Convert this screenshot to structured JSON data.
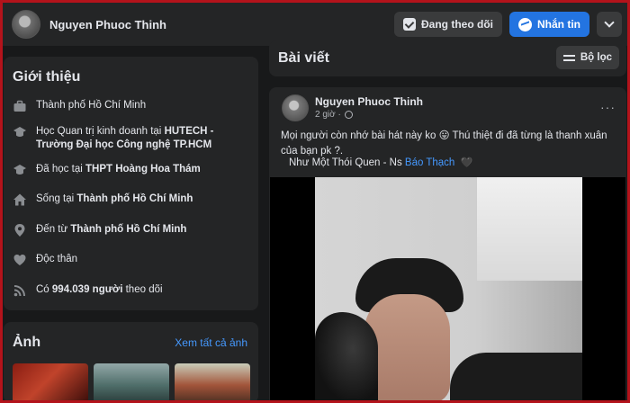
{
  "header": {
    "name": "Nguyen Phuoc Thinh",
    "following_label": "Đang theo dõi",
    "message_label": "Nhắn tin"
  },
  "intro": {
    "title": "Giới thiệu",
    "items": [
      {
        "icon": "briefcase-icon",
        "prefix": "Thành phố Hồ Chí Minh",
        "bold": ""
      },
      {
        "icon": "graduation-cap-icon",
        "prefix": "Học Quan trị kinh doanh tại ",
        "bold": "HUTECH - Trường Đại học Công nghệ TP.HCM"
      },
      {
        "icon": "graduation-cap-icon",
        "prefix": "Đã học tại ",
        "bold": "THPT Hoàng Hoa Thám"
      },
      {
        "icon": "home-icon",
        "prefix": "Sống tại ",
        "bold": "Thành phố Hồ Chí Minh"
      },
      {
        "icon": "location-pin-icon",
        "prefix": "Đến từ ",
        "bold": "Thành phố Hồ Chí Minh"
      },
      {
        "icon": "heart-icon",
        "prefix": "Độc thân",
        "bold": ""
      },
      {
        "icon": "rss-icon",
        "prefix": "Có ",
        "bold": "994.039 người",
        "suffix": " theo dõi"
      }
    ]
  },
  "photos": {
    "title": "Ảnh",
    "see_all": "Xem tất cả ảnh"
  },
  "posts": {
    "title": "Bài viết",
    "filter_label": "Bộ lọc"
  },
  "post": {
    "author": "Nguyen Phuoc Thinh",
    "time": "2 giờ ·",
    "more": "···",
    "text": "Mọi người còn nhớ bài hát này ko 😛 Thú thiệt đi đã từng là thanh xuân của bạn pk ?.",
    "song_prefix": "Như Một Thói Quen - Ns ",
    "song_link": "Báo Thạch",
    "song_emoji": "🖤"
  }
}
